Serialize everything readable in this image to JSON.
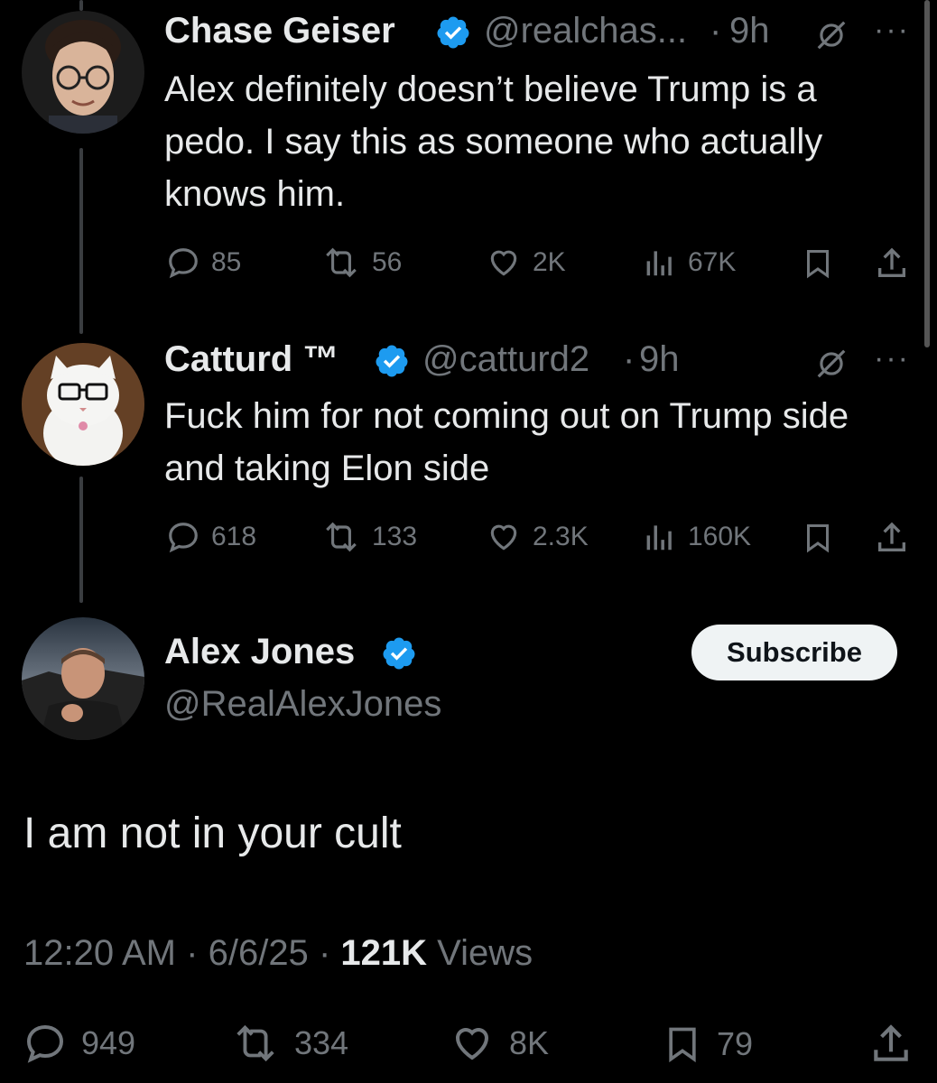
{
  "colors": {
    "background": "#000000",
    "text": "#e7e9ea",
    "muted": "#71767b",
    "verified": "#1d9bf0",
    "thread_line": "#3a3d40"
  },
  "tweets": [
    {
      "name": "Chase Geiser",
      "handle": "@realchas...",
      "sep": "·",
      "time": "9h",
      "text": "Alex definitely doesn’t believe Trump is a pedo. I say this as someone who actually knows him.",
      "stats": {
        "replies": "85",
        "reposts": "56",
        "likes": "2K",
        "views": "67K"
      },
      "icons": [
        "grok-icon",
        "more-icon",
        "reply-icon",
        "repost-icon",
        "like-icon",
        "views-icon",
        "bookmark-icon",
        "share-icon"
      ]
    },
    {
      "name": "Catturd ™",
      "handle": "@catturd2",
      "sep": "·",
      "time": "9h",
      "text": "Fuck him for not coming out on Trump side and taking Elon side",
      "stats": {
        "replies": "618",
        "reposts": "133",
        "likes": "2.3K",
        "views": "160K"
      }
    }
  ],
  "main_tweet": {
    "name": "Alex Jones",
    "handle": "@RealAlexJones",
    "subscribe_label": "Subscribe",
    "text": "I am not in your cult",
    "time": "12:20 AM",
    "date": "6/6/25",
    "views_count": "121K",
    "views_label": "Views",
    "sep": "·",
    "stats": {
      "replies": "949",
      "reposts": "334",
      "likes": "8K",
      "bookmarks": "79"
    }
  },
  "more_glyph": "···"
}
